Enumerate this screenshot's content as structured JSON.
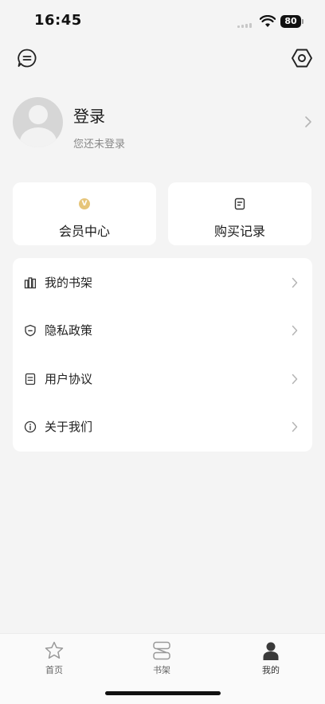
{
  "status_bar": {
    "time": "16:45",
    "battery": "80"
  },
  "header": {
    "message_icon": "message-icon",
    "settings_icon": "settings-hexagon-icon"
  },
  "profile": {
    "title": "登录",
    "subtitle": "您还未登录"
  },
  "cards": [
    {
      "label": "会员中心",
      "icon": "vip-badge-icon",
      "badge": "V"
    },
    {
      "label": "购买记录",
      "icon": "document-icon"
    }
  ],
  "menu": [
    {
      "label": "我的书架",
      "icon": "bookshelf-icon"
    },
    {
      "label": "隐私政策",
      "icon": "shield-icon"
    },
    {
      "label": "用户协议",
      "icon": "document-icon"
    },
    {
      "label": "关于我们",
      "icon": "info-icon"
    }
  ],
  "tabbar": [
    {
      "label": "首页",
      "icon": "star-icon"
    },
    {
      "label": "书架",
      "icon": "books-icon"
    },
    {
      "label": "我的",
      "icon": "person-icon",
      "active": true
    }
  ],
  "colors": {
    "background": "#f4f4f4",
    "card": "#ffffff",
    "vip_gold": "#e6c57a",
    "text": "#222222",
    "muted": "#888888"
  }
}
